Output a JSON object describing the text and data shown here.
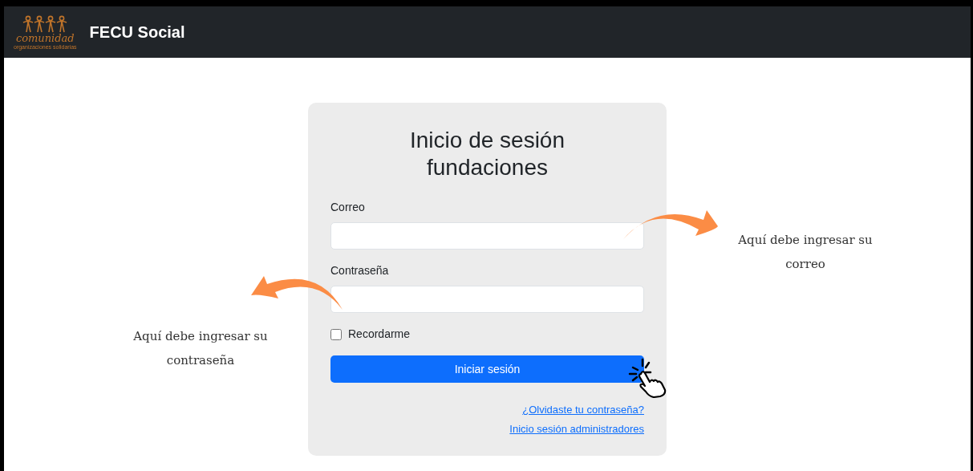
{
  "navbar": {
    "logo": {
      "word": "comunidad",
      "tagline": "organizaciones solidarias"
    },
    "brand": "FECU Social"
  },
  "login_card": {
    "title": "Inicio de sesión fundaciones",
    "fields": [
      {
        "label": "Correo"
      },
      {
        "label": "Contraseña"
      }
    ],
    "remember": {
      "label": "Recordarme",
      "checked": false
    },
    "submit": "Iniciar sesión",
    "links": [
      "¿Olvidaste tu contraseña?",
      "Inicio sesión administradores"
    ]
  },
  "annotations": {
    "email_hint": "Aquí debe ingresar su correo",
    "password_hint": "Aquí debe ingresar su contraseña"
  }
}
